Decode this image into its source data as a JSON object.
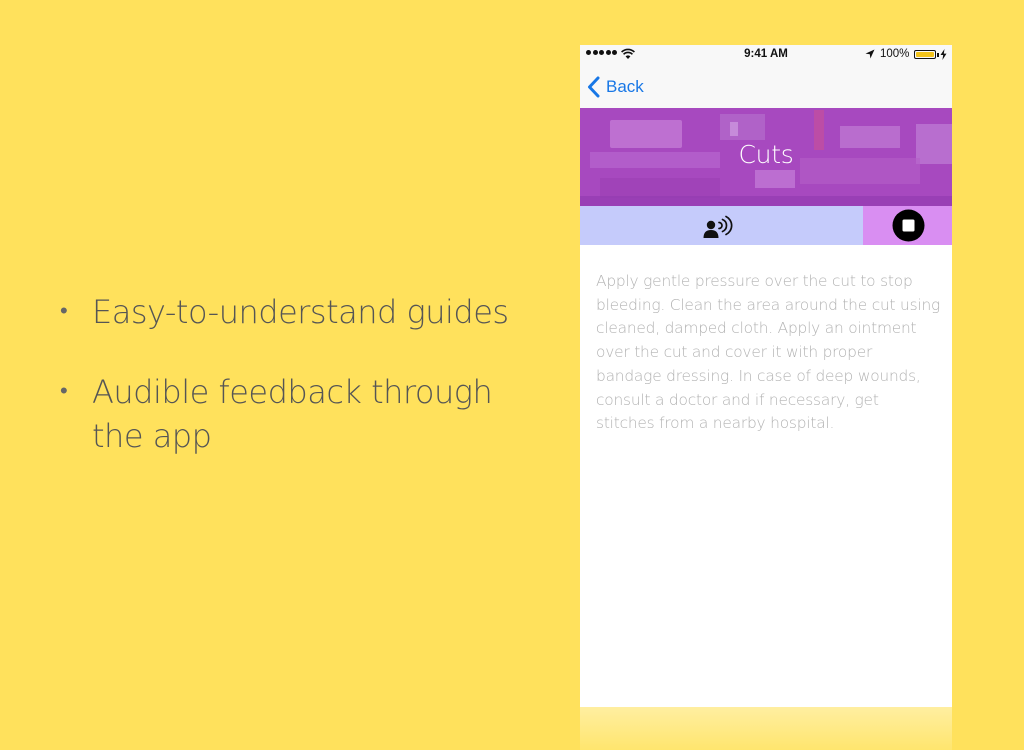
{
  "slide": {
    "bullets": [
      {
        "text": "Easy-to-understand guides"
      },
      {
        "text": "Audible feedback through the app"
      }
    ],
    "bullet_symbol": "•"
  },
  "phone": {
    "status_bar": {
      "time": "9:41 AM",
      "battery_percent": "100%",
      "battery_color": "#f2c31a"
    },
    "nav": {
      "back_label": "Back",
      "accent_color": "#1877e6"
    },
    "banner": {
      "title": "Cuts",
      "color": "#b04ec6"
    },
    "audio_controls": {
      "speak_icon": "speaking-person-icon",
      "stop_icon": "stop-icon",
      "speak_bg": "#c5cbfb",
      "stop_bg": "#d98ef2"
    },
    "guide_text": "Apply gentle pressure over the cut to stop bleeding. Clean the area around the cut using cleaned, damped cloth. Apply an ointment over the cut and cover it with proper bandage dressing. In case of deep wounds, consult a doctor and if necessary, get stitches from a nearby hospital."
  }
}
